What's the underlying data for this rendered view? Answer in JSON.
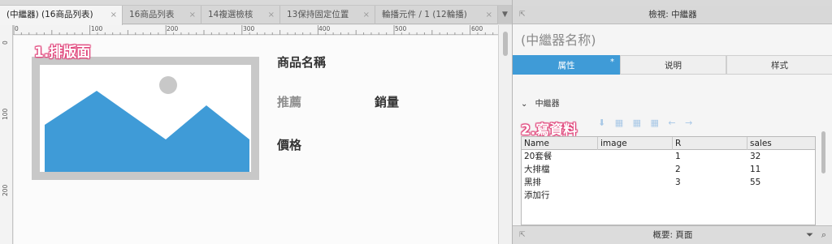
{
  "tabs": [
    {
      "label": "(中繼器) (16商品列表)",
      "active": true
    },
    {
      "label": "16商品列表",
      "active": false
    },
    {
      "label": "14複選檢核",
      "active": false
    },
    {
      "label": "13保持固定位置",
      "active": false
    },
    {
      "label": "輪播元件 / 1 (12輪播)",
      "active": false
    }
  ],
  "tab_close_glyph": "×",
  "tab_overflow_glyph": "▼",
  "ruler": {
    "h_labels": [
      "0",
      "100",
      "200",
      "300",
      "400",
      "500",
      "600"
    ],
    "v_labels": [
      "0",
      "100",
      "200"
    ]
  },
  "canvas": {
    "annotation_1": "1.排版面",
    "fields": {
      "name": "商品名稱",
      "recommend": "推薦",
      "sales": "銷量",
      "price": "價格"
    },
    "placeholder_colors": {
      "frame": "#c8c8c8",
      "mountain": "#3f9bd7",
      "sun": "#c8c8c8"
    }
  },
  "inspector": {
    "title": "檢視: 中繼器",
    "component_name": "(中繼器名称)",
    "tabs": [
      {
        "label": "属性",
        "active": true,
        "modified_marker": "*"
      },
      {
        "label": "说明",
        "active": false
      },
      {
        "label": "样式",
        "active": false
      }
    ],
    "section_title": "中繼器",
    "section_chevron": "⌄",
    "annotation_2": "2.寫資料",
    "toolbar_icons": "⬇ ▦ ▦ ▦ ← →",
    "dataset": {
      "columns": [
        "Name",
        "image",
        "R",
        "sales"
      ],
      "rows": [
        [
          "20套餐",
          "",
          "1",
          "32"
        ],
        [
          "大排檔",
          "",
          "2",
          "11"
        ],
        [
          "黑排",
          "",
          "3",
          "55"
        ]
      ],
      "add_row_label": "添加行"
    },
    "outline_title": "概要: 頁面",
    "pin_icon": "⇱",
    "filter_icon": "⏷",
    "search_icon": "⌕"
  },
  "colors": {
    "accent": "#3f9bd7",
    "annotation": "#e0457b"
  }
}
